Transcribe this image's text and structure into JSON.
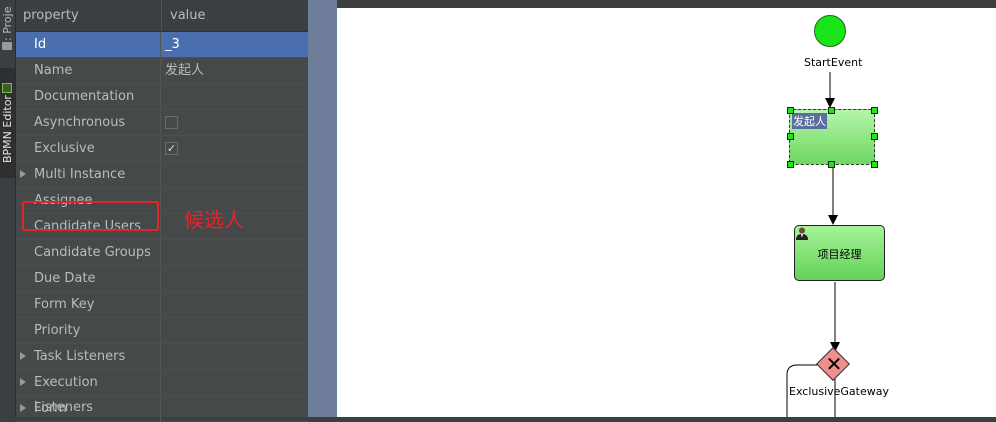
{
  "toolstrip": {
    "project_tab": "1: Proje",
    "bpmn_tab": "BPMN Editor"
  },
  "panel": {
    "header": {
      "property": "property",
      "value": "value"
    },
    "rows": [
      {
        "name": "Id",
        "value": "_3",
        "selected": true
      },
      {
        "name": "Name",
        "value": "发起人"
      },
      {
        "name": "Documentation",
        "value": ""
      },
      {
        "name": "Asynchronous",
        "value": "",
        "checkbox": false
      },
      {
        "name": "Exclusive",
        "value": "",
        "checkbox": true
      },
      {
        "name": "Multi Instance",
        "value": "",
        "expandable": true
      },
      {
        "name": "Assignee",
        "value": ""
      },
      {
        "name": "Candidate Users",
        "value": ""
      },
      {
        "name": "Candidate Groups",
        "value": ""
      },
      {
        "name": "Due Date",
        "value": ""
      },
      {
        "name": "Form Key",
        "value": ""
      },
      {
        "name": "Priority",
        "value": ""
      },
      {
        "name": "Task Listeners",
        "value": "",
        "expandable": true
      },
      {
        "name": "Execution Listeners",
        "value": "",
        "expandable": true
      },
      {
        "name": "Form",
        "value": "",
        "expandable": true
      }
    ]
  },
  "annotation": {
    "text": "候选人",
    "color": "#e8232a"
  },
  "diagram": {
    "start_event_label": "StartEvent",
    "task1_label": "发起人",
    "task2_label": "项目经理",
    "gateway_label": "ExclusiveGateway",
    "colors": {
      "start": "#18e418",
      "task": "#6ed761",
      "gateway": "#f08d8d",
      "selection": "#4b6eaf"
    }
  }
}
